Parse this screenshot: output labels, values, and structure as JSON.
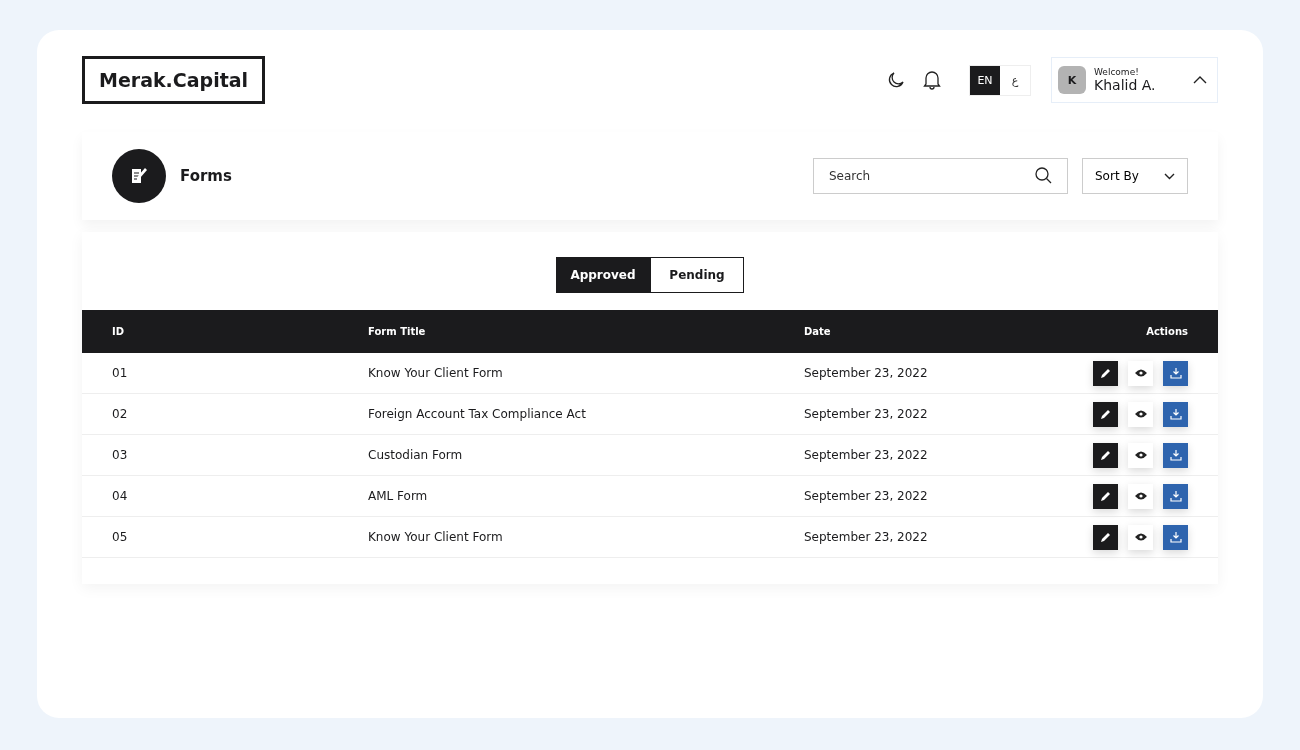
{
  "header": {
    "logo": "Merak.Capital",
    "languages": [
      {
        "label": "EN",
        "selected": true
      },
      {
        "label": "ع",
        "selected": false
      }
    ],
    "user": {
      "greeting": "Welcome!",
      "name": "Khalid A.",
      "initial": "K",
      "expanded": true
    }
  },
  "page": {
    "title": "Forms",
    "search": {
      "placeholder": "Search"
    },
    "sort": {
      "label": "Sort By"
    }
  },
  "tabs": [
    {
      "label": "Approved",
      "selected": true
    },
    {
      "label": "Pending",
      "selected": false
    }
  ],
  "table": {
    "columns": [
      "ID",
      "Form Title",
      "Date",
      "Actions"
    ],
    "rows": [
      {
        "id": "01",
        "title": "Know Your Client Form",
        "date": "September 23, 2022"
      },
      {
        "id": "02",
        "title": "Foreign Account Tax Compliance Act",
        "date": "September 23, 2022"
      },
      {
        "id": "03",
        "title": "Custodian Form",
        "date": "September 23, 2022"
      },
      {
        "id": "04",
        "title": "AML Form",
        "date": "September 23, 2022"
      },
      {
        "id": "05",
        "title": "Know Your Client Form",
        "date": "September 23, 2022"
      }
    ]
  }
}
